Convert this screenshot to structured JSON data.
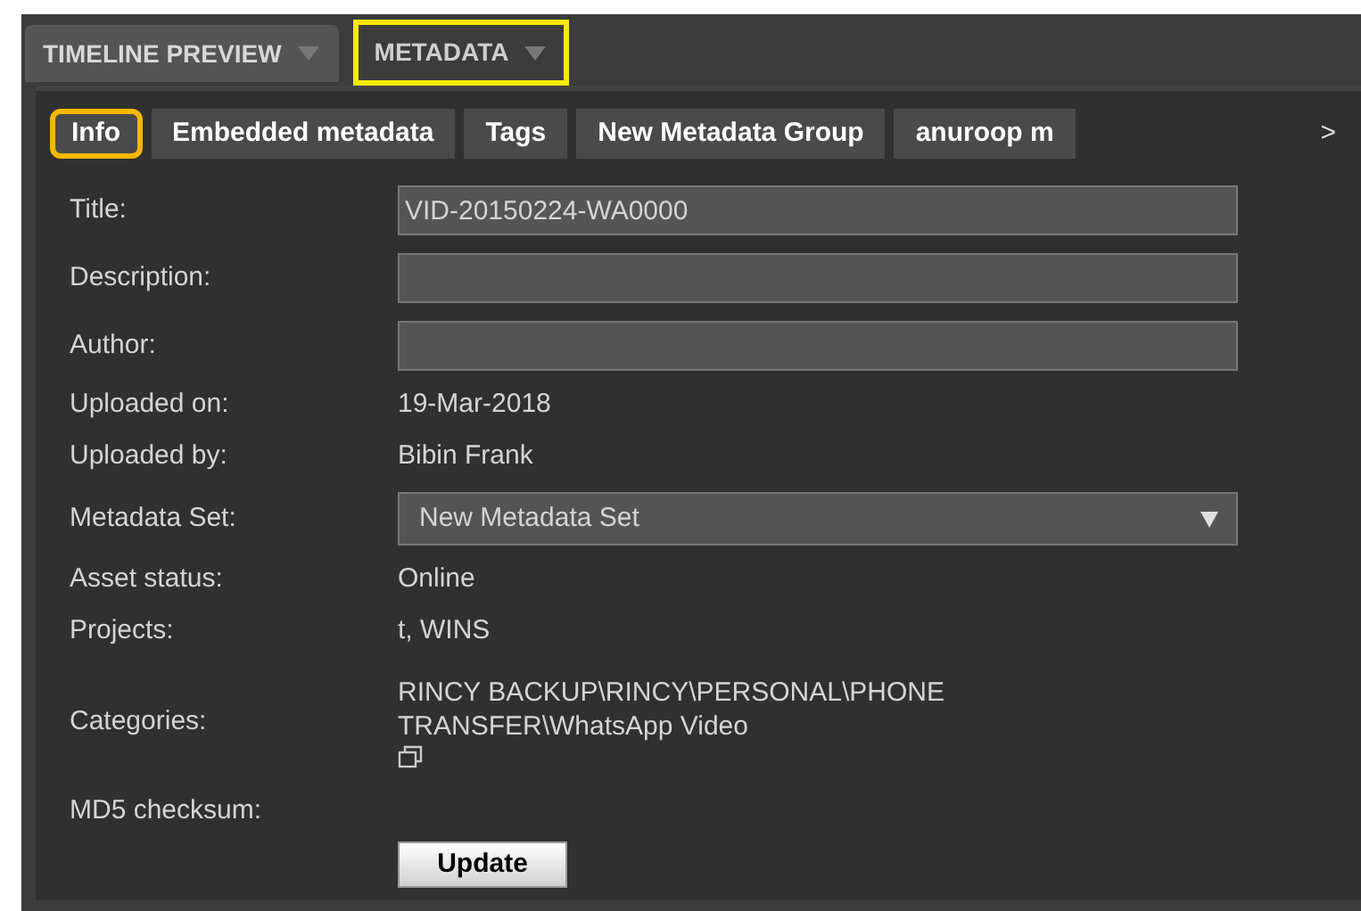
{
  "panel_tabs": [
    {
      "label": "TIMELINE PREVIEW",
      "selected": false
    },
    {
      "label": "METADATA",
      "selected": true
    }
  ],
  "sub_tabs": [
    {
      "label": "Info",
      "selected": true
    },
    {
      "label": "Embedded metadata",
      "selected": false
    },
    {
      "label": "Tags",
      "selected": false
    },
    {
      "label": "New Metadata Group",
      "selected": false
    },
    {
      "label": "anuroop m",
      "selected": false
    }
  ],
  "more_tabs": ">",
  "fields": [
    {
      "kind": "input",
      "label": "Title:",
      "value": "VID-20150224-WA0000"
    },
    {
      "kind": "input",
      "label": "Description:"
    },
    {
      "kind": "input",
      "label": "Author:"
    },
    {
      "kind": "text",
      "label": "Uploaded on:",
      "value": "19-Mar-2018"
    },
    {
      "kind": "text",
      "label": "Uploaded by:",
      "value": "Bibin Frank"
    },
    {
      "kind": "select",
      "label": "Metadata Set:",
      "value": "New Metadata Set"
    },
    {
      "kind": "text",
      "label": "Asset status:",
      "value": "Online"
    },
    {
      "kind": "text",
      "label": "Projects:",
      "value": "t, WINS"
    },
    {
      "kind": "categories",
      "label": "Categories:",
      "value": "RINCY BACKUP\\RINCY\\PERSONAL\\PHONE TRANSFER\\WhatsApp Video"
    },
    {
      "kind": "text",
      "label": "MD5 checksum:"
    }
  ],
  "update_button": "Update"
}
